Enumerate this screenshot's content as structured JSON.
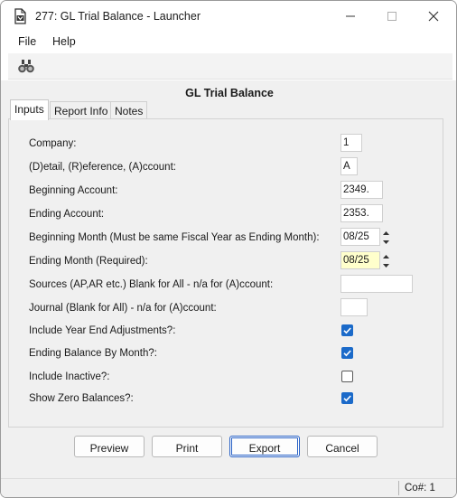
{
  "window": {
    "title": "277: GL Trial Balance - Launcher",
    "app_icon": "report-app-icon",
    "controls": [
      "minimize-icon",
      "maximize-icon",
      "close-icon"
    ]
  },
  "menu": {
    "items": [
      "File",
      "Help"
    ]
  },
  "toolbar": {
    "icons": [
      "binoculars-icon"
    ]
  },
  "form": {
    "title": "GL Trial Balance",
    "tabs": [
      {
        "label": "Inputs",
        "active": true
      },
      {
        "label": "Report Info",
        "active": false
      },
      {
        "label": "Notes",
        "active": false
      }
    ],
    "fields": [
      {
        "label": "Company:",
        "value": "1"
      },
      {
        "label": "(D)etail, (R)eference, (A)ccount:",
        "value": "A"
      },
      {
        "label": "Beginning Account:",
        "value": "2349."
      },
      {
        "label": "Ending Account:",
        "value": "2353."
      },
      {
        "label": "Beginning Month (Must be same Fiscal Year as Ending Month):",
        "value": "08/25"
      },
      {
        "label": "Ending Month (Required):",
        "value": "08/25"
      },
      {
        "label": "Sources (AP,AR etc.) Blank for All - n/a for (A)ccount:",
        "value": ""
      },
      {
        "label": "Journal (Blank for All) - n/a for (A)ccount:",
        "value": ""
      }
    ],
    "checks": [
      {
        "label": "Include Year End Adjustments?:",
        "checked": true
      },
      {
        "label": "Ending Balance By Month?:",
        "checked": true
      },
      {
        "label": "Include Inactive?:",
        "checked": false
      },
      {
        "label": "Show Zero Balances?:",
        "checked": true
      }
    ]
  },
  "buttons": {
    "preview": "Preview",
    "print": "Print",
    "export": "Export",
    "cancel": "Cancel"
  },
  "status": {
    "company": "Co#: 1"
  },
  "colors": {
    "accent": "#1b6ac9",
    "highlight_field": "#ffffcc",
    "default_button_border": "#2b63c6"
  }
}
